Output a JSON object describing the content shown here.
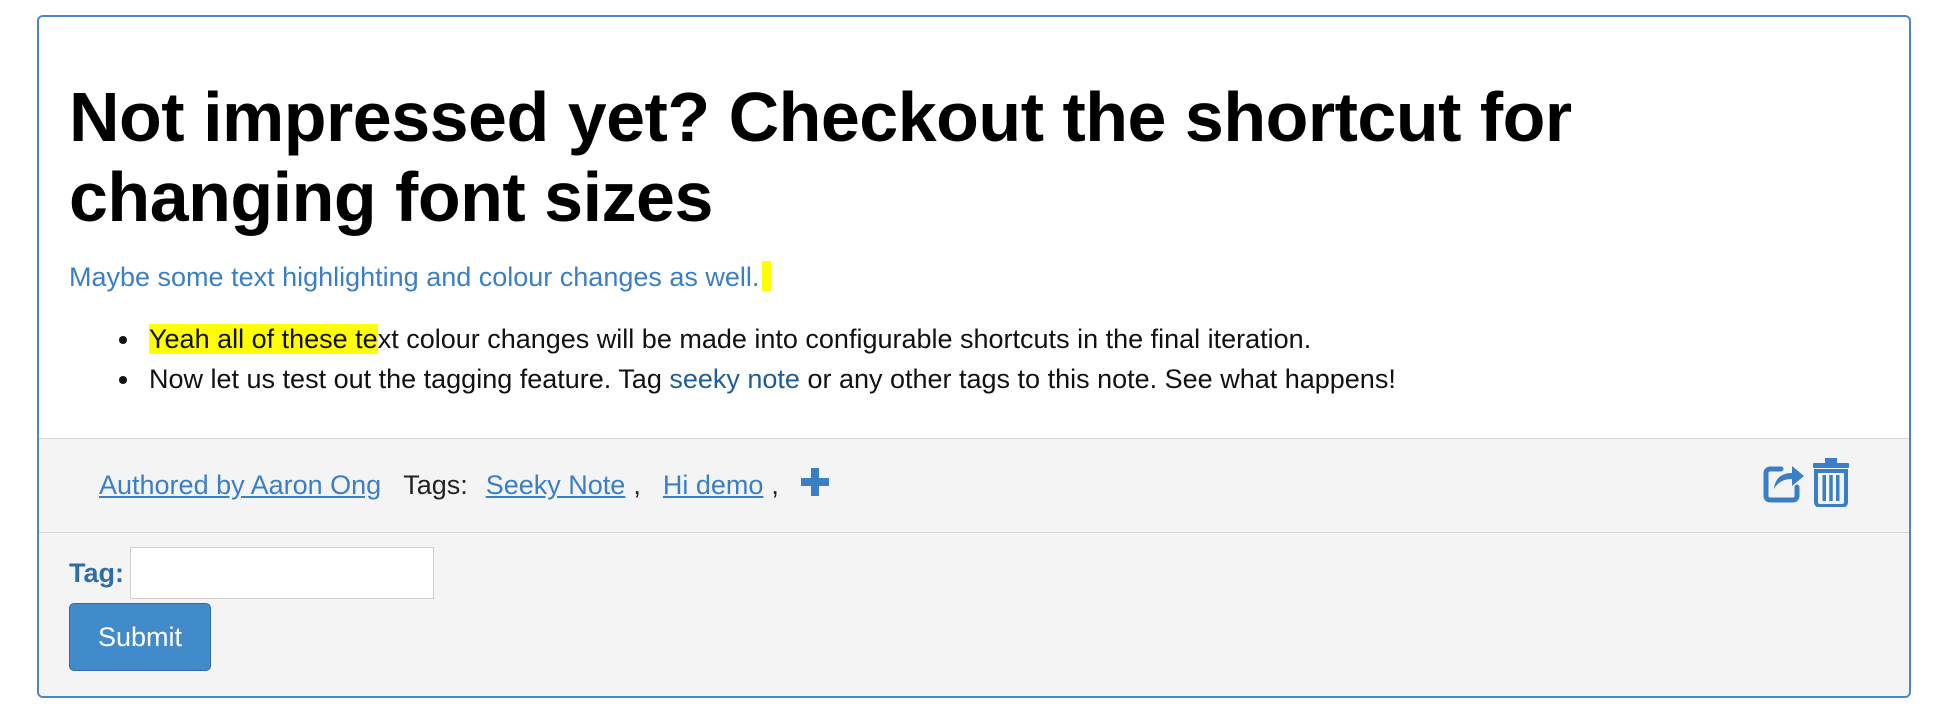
{
  "note": {
    "title": "Not impressed yet? Checkout the shortcut for changing font sizes",
    "subtitle": "Maybe some text highlighting and colour changes as well.",
    "bullets": [
      {
        "highlighted": "Yeah all of these te",
        "rest": "xt colour changes will be made into configurable shortcuts in the final iteration."
      },
      {
        "before": "Now let us test out the tagging feature. Tag ",
        "link": "seeky note",
        "after": " or any other tags to this note. See what happens!"
      }
    ]
  },
  "meta": {
    "author": "Authored by Aaron Ong",
    "tags_label": "Tags:",
    "tags": [
      "Seeky Note",
      "Hi demo"
    ],
    "separator": ",",
    "add_icon": "plus-icon",
    "share_icon": "share-icon",
    "delete_icon": "trash-icon"
  },
  "tag_form": {
    "label": "Tag:",
    "input_value": "",
    "submit_label": "Submit"
  },
  "colors": {
    "border": "#4a86c5",
    "link": "#3a7fc5",
    "highlight": "#ffff00",
    "button": "#428bca"
  }
}
